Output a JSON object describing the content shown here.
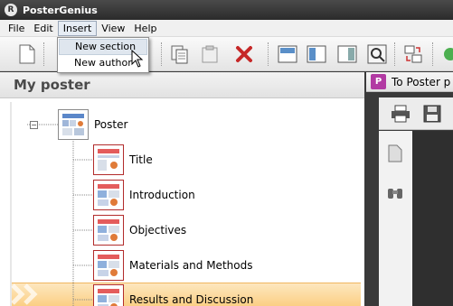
{
  "app": {
    "title": "PosterGenius",
    "icon_name": "postergenius-logo-icon"
  },
  "menubar": {
    "items": [
      "File",
      "Edit",
      "Insert",
      "View",
      "Help"
    ],
    "active": "Insert"
  },
  "dropdown": {
    "items": [
      "New section",
      "New author"
    ],
    "hovered": "New section"
  },
  "toolbar": {
    "buttons": [
      "new-document-icon",
      "copy-icon",
      "paste-icon",
      "delete-icon",
      "layout-top-icon",
      "layout-left-icon",
      "layout-columns-icon",
      "zoom-icon",
      "arrange-icon",
      "go-icon"
    ]
  },
  "left_panel": {
    "title": "My poster"
  },
  "tree": {
    "root": {
      "label": "Poster",
      "expander": "−"
    },
    "children": [
      {
        "label": "Title"
      },
      {
        "label": "Introduction"
      },
      {
        "label": "Objectives"
      },
      {
        "label": "Materials and Methods"
      },
      {
        "label": "Results and Discussion",
        "selected": true
      }
    ]
  },
  "right_panel": {
    "tab_label": "To Poster p",
    "pdf_glyph": "P"
  },
  "colors": {
    "selection": "#fbcf84",
    "thumb_border": "#b22c2c",
    "titlebar": "#2b2b2b"
  }
}
